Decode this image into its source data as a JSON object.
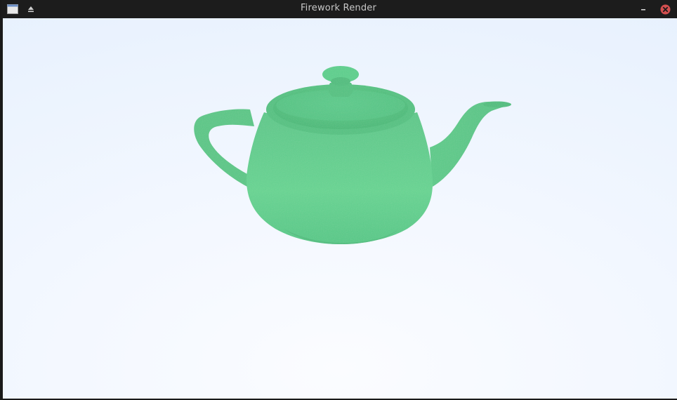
{
  "window": {
    "title": "Firework Render"
  },
  "titlebar": {
    "menu_icon": "window-menu-icon",
    "shade_icon": "eject-icon",
    "minimize_icon": "minimize-icon",
    "close_icon": "close-icon"
  },
  "render": {
    "subject": "teapot",
    "model_color": "#5fd08a",
    "background_top": "#e6f0fd",
    "background_bottom": "#fbfcff"
  }
}
